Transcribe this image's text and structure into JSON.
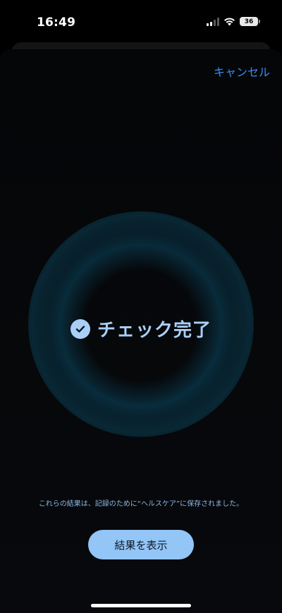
{
  "status_bar": {
    "time": "16:49",
    "battery": "36",
    "icons": [
      "signal-icon",
      "wifi-icon",
      "battery-icon"
    ]
  },
  "sheet": {
    "cancel_label": "キャンセル",
    "completion_label": "チェック完了",
    "check_icon": "checkmark-circle-icon",
    "saved_note": "これらの結果は、記録のために“ヘルスケア”に保存されました。",
    "results_button_label": "結果を表示"
  },
  "colors": {
    "accent_link": "#3a8cf0",
    "completion_text": "#a9cff7",
    "button_background": "#93c5f6",
    "background": "#000000"
  }
}
